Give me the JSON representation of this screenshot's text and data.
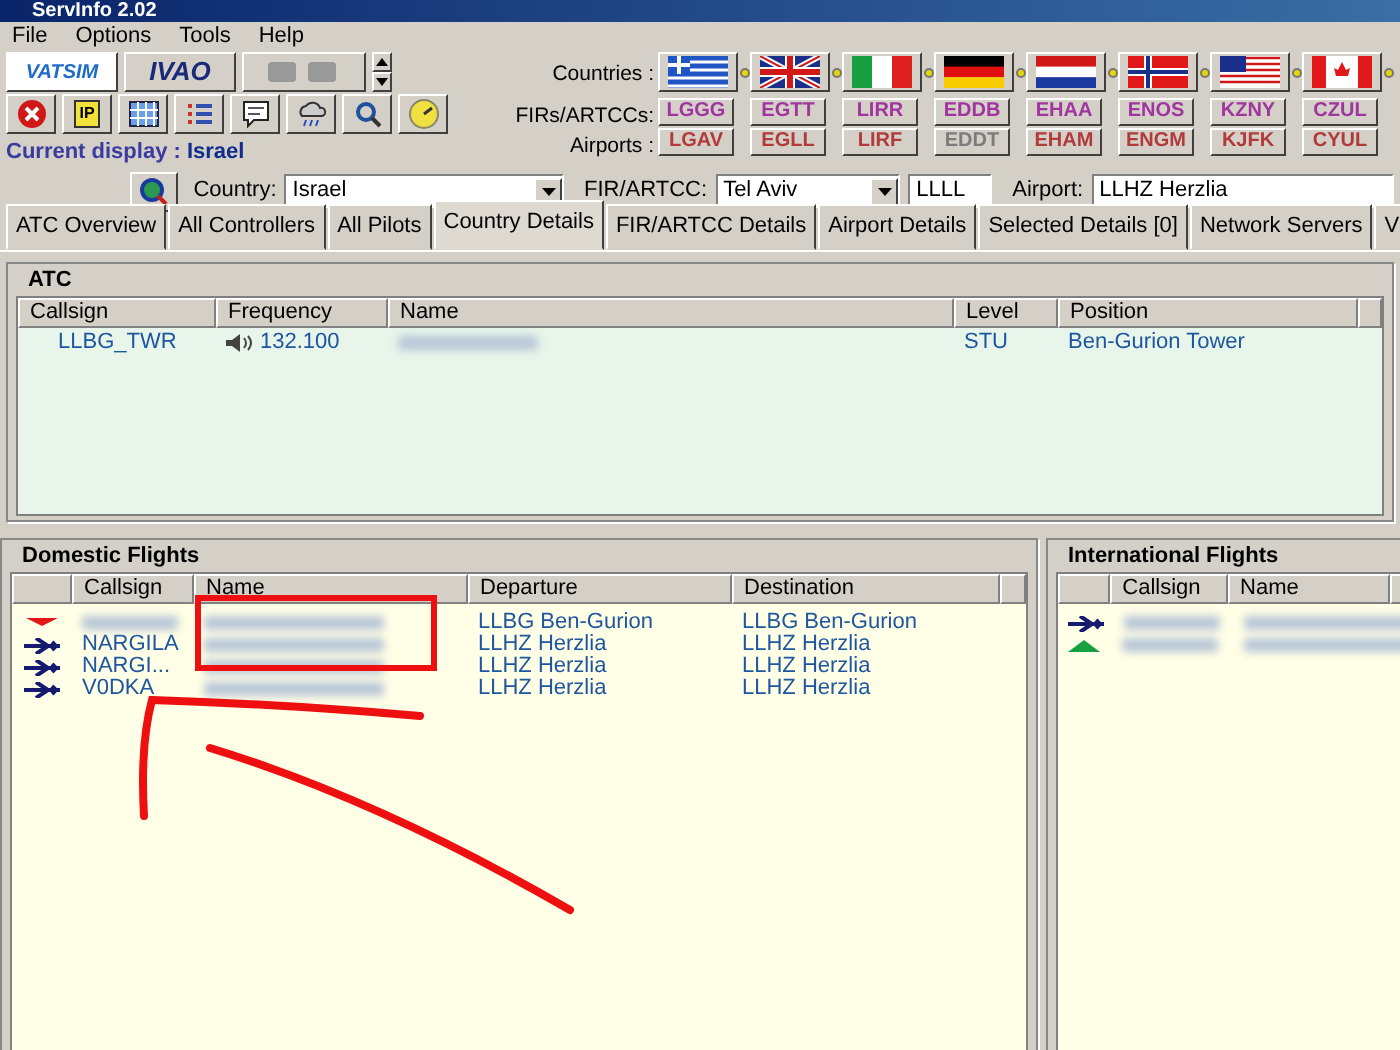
{
  "window": {
    "title": "ServInfo 2.02"
  },
  "menu": [
    "File",
    "Options",
    "Tools",
    "Help"
  ],
  "networks": [
    "VATSIM",
    "IVAO"
  ],
  "toolbar": {
    "ip_label": "IP"
  },
  "current_display": {
    "label": "Current display :",
    "value": "Israel"
  },
  "selector_labels": {
    "countries": "Countries :",
    "firs": "FIRs/ARTCCs:",
    "airports": "Airports :"
  },
  "countries": [
    {
      "kind": "greece",
      "fir": "LGGG",
      "airport": "LGAV",
      "airport_disabled": false
    },
    {
      "kind": "uk",
      "fir": "EGTT",
      "airport": "EGLL",
      "airport_disabled": false
    },
    {
      "kind": "italy",
      "fir": "LIRR",
      "airport": "LIRF",
      "airport_disabled": false
    },
    {
      "kind": "germany",
      "fir": "EDDB",
      "airport": "EDDT",
      "airport_disabled": true
    },
    {
      "kind": "netherlands",
      "fir": "EHAA",
      "airport": "EHAM",
      "airport_disabled": false
    },
    {
      "kind": "norway",
      "fir": "ENOS",
      "airport": "ENGM",
      "airport_disabled": false
    },
    {
      "kind": "usa",
      "fir": "KZNY",
      "airport": "KJFK",
      "airport_disabled": false
    },
    {
      "kind": "canada",
      "fir": "CZUL",
      "airport": "CYUL",
      "airport_disabled": false
    }
  ],
  "filters": {
    "country_label": "Country:",
    "country": "Israel",
    "fir_label": "FIR/ARTCC:",
    "fir": "Tel Aviv",
    "fir_code": "LLLL",
    "airport_label": "Airport:",
    "airport": "LLHZ Herzlia"
  },
  "tabs": [
    {
      "label": "ATC Overview",
      "selected": false
    },
    {
      "label": "All Controllers",
      "selected": false
    },
    {
      "label": "All Pilots",
      "selected": false
    },
    {
      "label": "Country Details",
      "selected": true
    },
    {
      "label": "FIR/ARTCC Details",
      "selected": false
    },
    {
      "label": "Airport Details",
      "selected": false
    },
    {
      "label": "Selected Details [0]",
      "selected": false
    },
    {
      "label": "Network Servers",
      "selected": false
    },
    {
      "label": "V",
      "selected": false
    }
  ],
  "atc": {
    "title": "ATC",
    "columns": [
      "Callsign",
      "Frequency",
      "Name",
      "Level",
      "Position"
    ],
    "rows": [
      {
        "callsign": "LLBG_TWR",
        "frequency": "132.100",
        "level": "STU",
        "position": "Ben-Gurion Tower"
      }
    ]
  },
  "domestic": {
    "title": "Domestic Flights",
    "columns": [
      "Callsign",
      "Name",
      "Departure",
      "Destination"
    ],
    "rows": [
      {
        "kind": "arrival",
        "callsign_blurred": true,
        "departure": "LLBG Ben-Gurion",
        "destination": "LLBG Ben-Gurion"
      },
      {
        "kind": "airborne",
        "callsign": "NARGILA",
        "callsign_blurred": false,
        "departure": "LLHZ Herzlia",
        "destination": "LLHZ Herzlia"
      },
      {
        "kind": "airborne",
        "callsign": "NARGI...",
        "callsign_blurred": false,
        "departure": "LLHZ Herzlia",
        "destination": "LLHZ Herzlia"
      },
      {
        "kind": "airborne",
        "callsign": "V0DKA",
        "callsign_blurred": false,
        "departure": "LLHZ Herzlia",
        "destination": "LLHZ Herzlia"
      }
    ]
  },
  "international": {
    "title": "International Flights",
    "columns": [
      "Callsign",
      "Name"
    ],
    "rows": [
      {
        "kind": "airborne",
        "callsign_blurred": true
      },
      {
        "kind": "departure",
        "callsign_blurred": true
      }
    ]
  }
}
